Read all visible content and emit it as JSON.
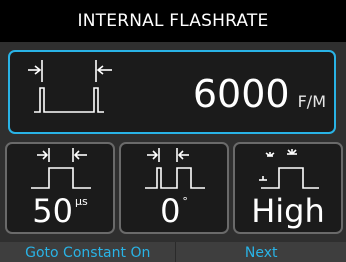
{
  "header": {
    "title": "INTERNAL FLASHRATE"
  },
  "flash_rate": {
    "value": "6000",
    "unit": "F/M"
  },
  "pulse_width": {
    "value": "50",
    "unit": "µs"
  },
  "delay": {
    "value": "0",
    "unit": "°"
  },
  "level": {
    "value": "High"
  },
  "footer": {
    "left_label": "Goto Constant On",
    "right_label": "Next"
  },
  "colors": {
    "accent": "#29b3e6",
    "background": "#2f2f2f",
    "panel": "#1b1b1b"
  },
  "icons": [
    "pulse-period-icon",
    "pulse-width-icon",
    "delay-icon",
    "level-icon"
  ]
}
